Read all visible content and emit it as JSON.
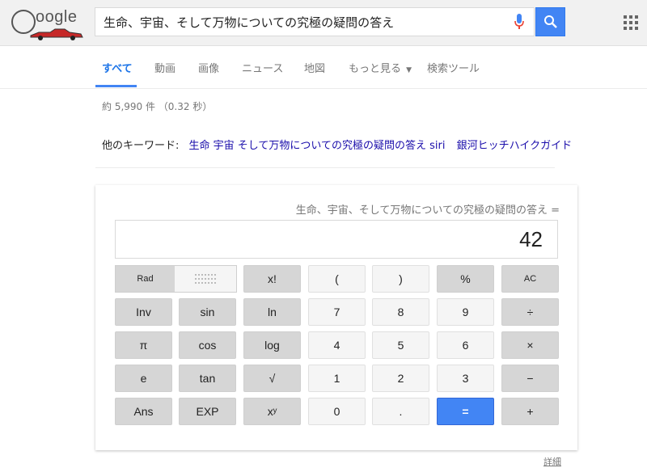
{
  "header": {
    "logo_text": "oogle",
    "search_query": "生命、宇宙、そして万物についての究極の疑問の答え",
    "colors": {
      "search_button": "#4285f4",
      "mic_blue": "#4285f4",
      "mic_red": "#ea4335"
    }
  },
  "tabs": [
    {
      "label": "すべて",
      "active": true
    },
    {
      "label": "動画"
    },
    {
      "label": "画像"
    },
    {
      "label": "ニュース"
    },
    {
      "label": "地図"
    },
    {
      "label": "もっと見る"
    },
    {
      "label": "検索ツール"
    }
  ],
  "results": {
    "count_text": "約 5,990 件 （0.32 秒）",
    "related_prefix": "他のキーワード:",
    "related_links": [
      "生命 宇宙 そして万物についての究極の疑問の答え siri",
      "銀河ヒッチハイクガイド"
    ]
  },
  "calculator": {
    "expression": "生命、宇宙、そして万物についての究極の疑問の答え =",
    "value": "42",
    "mode_left": "Rad",
    "rows": [
      [
        "x!",
        "(",
        ")",
        "%",
        "AC"
      ],
      [
        "Inv",
        "sin",
        "ln",
        "7",
        "8",
        "9",
        "÷"
      ],
      [
        "π",
        "cos",
        "log",
        "4",
        "5",
        "6",
        "×"
      ],
      [
        "e",
        "tan",
        "√",
        "1",
        "2",
        "3",
        "−"
      ],
      [
        "Ans",
        "EXP",
        "xʸ",
        "0",
        ".",
        "=",
        "+"
      ]
    ],
    "more_link": "詳細"
  }
}
